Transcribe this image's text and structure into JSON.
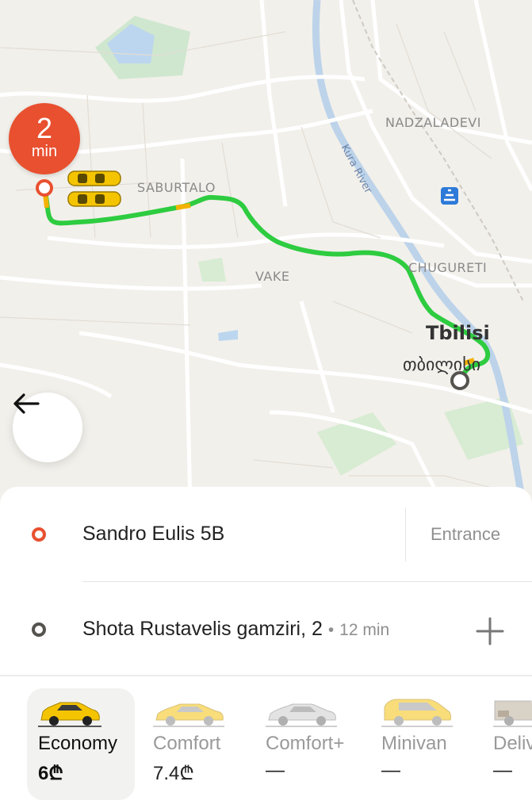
{
  "map": {
    "eta": {
      "number": "2",
      "unit": "min"
    },
    "labels": {
      "nadzaladevi": "NADZALADEVI",
      "saburtalo": "SABURTALO",
      "chugureti": "CHUGURETI",
      "vake": "VAKE",
      "river": "Kura River",
      "city": "Tbilisi",
      "city_local": "თბილისი"
    }
  },
  "route": {
    "origin": {
      "address": "Sandro Eulis 5B",
      "entrance_label": "Entrance"
    },
    "destination": {
      "address": "Shota Rustavelis gamziri, 2",
      "eta": "12 min",
      "separator": "•"
    }
  },
  "tariffs": [
    {
      "name": "Economy",
      "price": "6₾",
      "selected": true,
      "car_color": "#f5c400"
    },
    {
      "name": "Comfort",
      "price": "7.4₾",
      "selected": false,
      "car_color": "#f8dd7a"
    },
    {
      "name": "Comfort+",
      "price": "—",
      "selected": false,
      "car_color": "#e3e3e3"
    },
    {
      "name": "Minivan",
      "price": "—",
      "selected": false,
      "car_color": "#f8dd7a"
    },
    {
      "name": "Deliv",
      "price": "—",
      "selected": false,
      "car_color": "#d9d2c6"
    }
  ],
  "colors": {
    "accent": "#e8502f",
    "route": "#2ecc40",
    "taxi": "#f5c400"
  }
}
